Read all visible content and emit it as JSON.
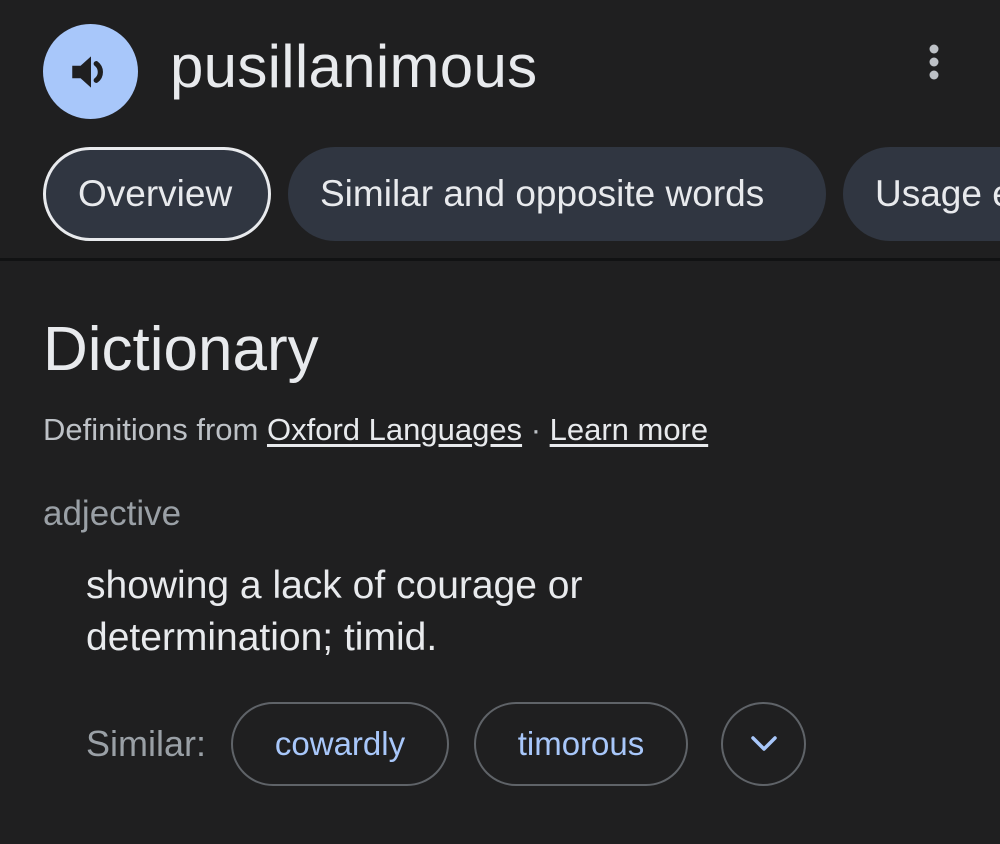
{
  "header": {
    "word": "pusillanimous"
  },
  "tabs": [
    {
      "label": "Overview",
      "active": true
    },
    {
      "label": "Similar and opposite words",
      "active": false
    },
    {
      "label": "Usage examples",
      "active": false
    }
  ],
  "dictionary": {
    "title": "Dictionary",
    "source_prefix": "Definitions from",
    "source_link": "Oxford Languages",
    "separator": "·",
    "learn_more": "Learn more",
    "part_of_speech": "adjective",
    "definition": "showing a lack of courage or determination; timid.",
    "similar_label": "Similar:",
    "similar_words": [
      "cowardly",
      "timorous"
    ]
  },
  "icons": {
    "speaker": "speaker-icon",
    "more": "more-vert-icon",
    "expand": "chevron-down-icon"
  },
  "colors": {
    "background": "#1f1f20",
    "accent": "#a8c7fa",
    "tab_background": "#303641",
    "chip_border": "#5f6368"
  }
}
